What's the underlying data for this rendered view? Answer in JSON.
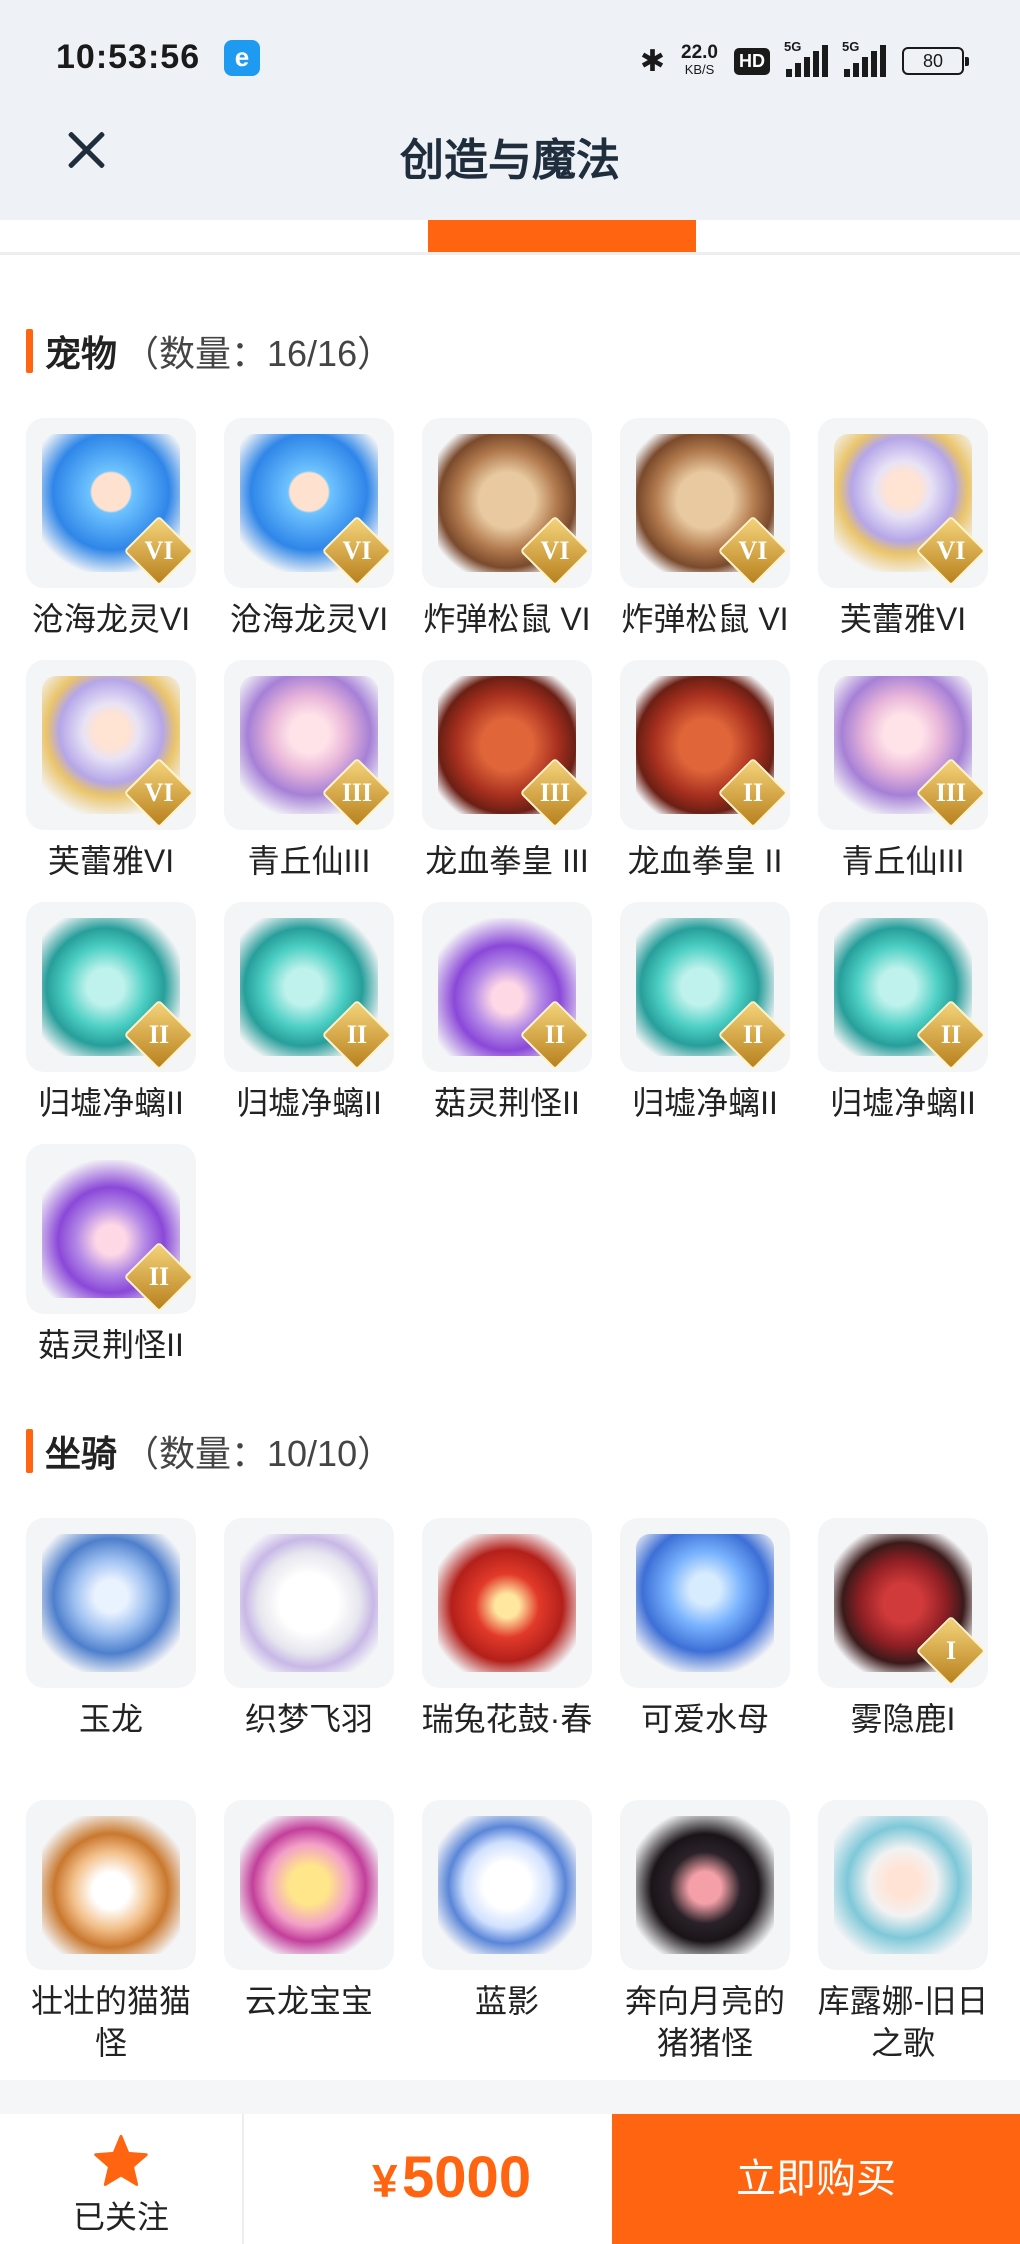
{
  "status_bar": {
    "time": "10:53:56",
    "app_badge": "e",
    "net_speed": "22.0",
    "net_speed_unit": "KB/S",
    "hd": "HD",
    "sim1_label": "5G",
    "sim2_label": "5G",
    "battery": "80"
  },
  "header": {
    "title": "创造与魔法"
  },
  "pets": {
    "title": "宠物",
    "count": "（数量：16/16）",
    "items": [
      {
        "name": "沧海龙灵VI",
        "rank": "VI",
        "art": "dragon"
      },
      {
        "name": "沧海龙灵VI",
        "rank": "VI",
        "art": "dragon"
      },
      {
        "name": "炸弹松鼠 VI",
        "rank": "VI",
        "art": "squirrel"
      },
      {
        "name": "炸弹松鼠 VI",
        "rank": "VI",
        "art": "squirrel"
      },
      {
        "name": "芙蕾雅VI",
        "rank": "VI",
        "art": "fulei"
      },
      {
        "name": "芙蕾雅VI",
        "rank": "VI",
        "art": "fulei"
      },
      {
        "name": "青丘仙III",
        "rank": "III",
        "art": "qingqiu"
      },
      {
        "name": "龙血拳皇 III",
        "rank": "III",
        "art": "longxue"
      },
      {
        "name": "龙血拳皇 II",
        "rank": "II",
        "art": "longxue"
      },
      {
        "name": "青丘仙III",
        "rank": "III",
        "art": "qingqiu"
      },
      {
        "name": "归墟净螭II",
        "rank": "II",
        "art": "guixu"
      },
      {
        "name": "归墟净螭II",
        "rank": "II",
        "art": "guixu"
      },
      {
        "name": "菇灵荆怪II",
        "rank": "II",
        "art": "gu"
      },
      {
        "name": "归墟净螭II",
        "rank": "II",
        "art": "guixu"
      },
      {
        "name": "归墟净螭II",
        "rank": "II",
        "art": "guixu"
      },
      {
        "name": "菇灵荆怪II",
        "rank": "II",
        "art": "gu"
      }
    ]
  },
  "mounts": {
    "title": "坐骑",
    "count": "（数量：10/10）",
    "items": [
      {
        "name": "玉龙",
        "art": "yulong"
      },
      {
        "name": "织梦飞羽",
        "art": "zhimeng"
      },
      {
        "name": "瑞兔花鼓·春",
        "art": "ruitu"
      },
      {
        "name": "可爱水母",
        "art": "shuimu"
      },
      {
        "name": "雾隐鹿I",
        "rank": "I",
        "art": "wuyin"
      },
      {
        "name": "壮壮的猫猫怪",
        "art": "mao"
      },
      {
        "name": "云龙宝宝",
        "art": "yunlong"
      },
      {
        "name": "蓝影",
        "art": "lanying"
      },
      {
        "name": "奔向月亮的猪猪怪",
        "art": "zhuzhu"
      },
      {
        "name": "库露娜-旧日之歌",
        "art": "kulu"
      }
    ]
  },
  "bottom_bar": {
    "follow_label": "已关注",
    "currency_symbol": "¥",
    "price": "5000",
    "buy_label": "立即购买"
  },
  "colors": {
    "accent": "#ff6410",
    "header_bg": "#eef2f6"
  },
  "icons": {
    "close": "close-icon",
    "follow": "star-icon",
    "bluetooth": "bluetooth-icon"
  }
}
